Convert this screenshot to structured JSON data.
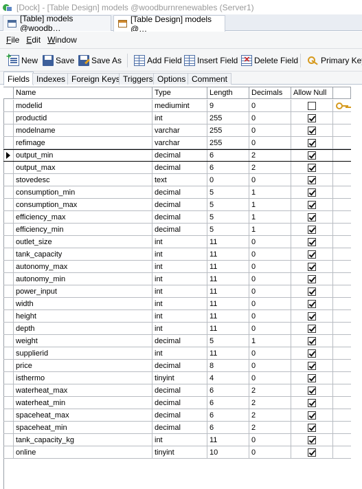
{
  "window": {
    "title": "[Dock] - [Table Design] models @woodburnrenewables (Server1)"
  },
  "doc_tabs": [
    {
      "label": "[Table] models @woodb…",
      "active": false
    },
    {
      "label": "[Table Design] models @…",
      "active": true
    }
  ],
  "menu": [
    {
      "label": "File",
      "mnemonic": "F"
    },
    {
      "label": "Edit",
      "mnemonic": "E"
    },
    {
      "label": "Window",
      "mnemonic": "W"
    }
  ],
  "toolbar": {
    "new_label": "New",
    "save_label": "Save",
    "save_as_label": "Save As",
    "add_field_label": "Add Field",
    "insert_field_label": "Insert Field",
    "delete_field_label": "Delete Field",
    "primary_key_label": "Primary Key"
  },
  "subtabs": [
    "Fields",
    "Indexes",
    "Foreign Keys",
    "Triggers",
    "Options",
    "Comment"
  ],
  "columns": [
    "Name",
    "Type",
    "Length",
    "Decimals",
    "Allow Null"
  ],
  "fields": [
    {
      "name": "modelid",
      "type": "mediumint",
      "length": "9",
      "decimals": "0",
      "allow_null": false,
      "primary_key": true
    },
    {
      "name": "productid",
      "type": "int",
      "length": "255",
      "decimals": "0",
      "allow_null": true
    },
    {
      "name": "modelname",
      "type": "varchar",
      "length": "255",
      "decimals": "0",
      "allow_null": true
    },
    {
      "name": "refimage",
      "type": "varchar",
      "length": "255",
      "decimals": "0",
      "allow_null": true
    },
    {
      "name": "output_min",
      "type": "decimal",
      "length": "6",
      "decimals": "2",
      "allow_null": true,
      "selected": true
    },
    {
      "name": "output_max",
      "type": "decimal",
      "length": "6",
      "decimals": "2",
      "allow_null": true
    },
    {
      "name": "stovedesc",
      "type": "text",
      "length": "0",
      "decimals": "0",
      "allow_null": true
    },
    {
      "name": "consumption_min",
      "type": "decimal",
      "length": "5",
      "decimals": "1",
      "allow_null": true
    },
    {
      "name": "consumption_max",
      "type": "decimal",
      "length": "5",
      "decimals": "1",
      "allow_null": true
    },
    {
      "name": "efficiency_max",
      "type": "decimal",
      "length": "5",
      "decimals": "1",
      "allow_null": true
    },
    {
      "name": "efficiency_min",
      "type": "decimal",
      "length": "5",
      "decimals": "1",
      "allow_null": true
    },
    {
      "name": "outlet_size",
      "type": "int",
      "length": "11",
      "decimals": "0",
      "allow_null": true
    },
    {
      "name": "tank_capacity",
      "type": "int",
      "length": "11",
      "decimals": "0",
      "allow_null": true
    },
    {
      "name": "autonomy_max",
      "type": "int",
      "length": "11",
      "decimals": "0",
      "allow_null": true
    },
    {
      "name": "autonomy_min",
      "type": "int",
      "length": "11",
      "decimals": "0",
      "allow_null": true
    },
    {
      "name": "power_input",
      "type": "int",
      "length": "11",
      "decimals": "0",
      "allow_null": true
    },
    {
      "name": "width",
      "type": "int",
      "length": "11",
      "decimals": "0",
      "allow_null": true
    },
    {
      "name": "height",
      "type": "int",
      "length": "11",
      "decimals": "0",
      "allow_null": true
    },
    {
      "name": "depth",
      "type": "int",
      "length": "11",
      "decimals": "0",
      "allow_null": true
    },
    {
      "name": "weight",
      "type": "decimal",
      "length": "5",
      "decimals": "1",
      "allow_null": true
    },
    {
      "name": "supplierid",
      "type": "int",
      "length": "11",
      "decimals": "0",
      "allow_null": true
    },
    {
      "name": "price",
      "type": "decimal",
      "length": "8",
      "decimals": "0",
      "allow_null": true
    },
    {
      "name": "isthermo",
      "type": "tinyint",
      "length": "4",
      "decimals": "0",
      "allow_null": true
    },
    {
      "name": "waterheat_max",
      "type": "decimal",
      "length": "6",
      "decimals": "2",
      "allow_null": true
    },
    {
      "name": "waterheat_min",
      "type": "decimal",
      "length": "6",
      "decimals": "2",
      "allow_null": true
    },
    {
      "name": "spaceheat_max",
      "type": "decimal",
      "length": "6",
      "decimals": "2",
      "allow_null": true
    },
    {
      "name": "spaceheat_min",
      "type": "decimal",
      "length": "6",
      "decimals": "2",
      "allow_null": true
    },
    {
      "name": "tank_capacity_kg",
      "type": "int",
      "length": "11",
      "decimals": "0",
      "allow_null": true
    },
    {
      "name": "online",
      "type": "tinyint",
      "length": "10",
      "decimals": "0",
      "allow_null": true
    }
  ]
}
